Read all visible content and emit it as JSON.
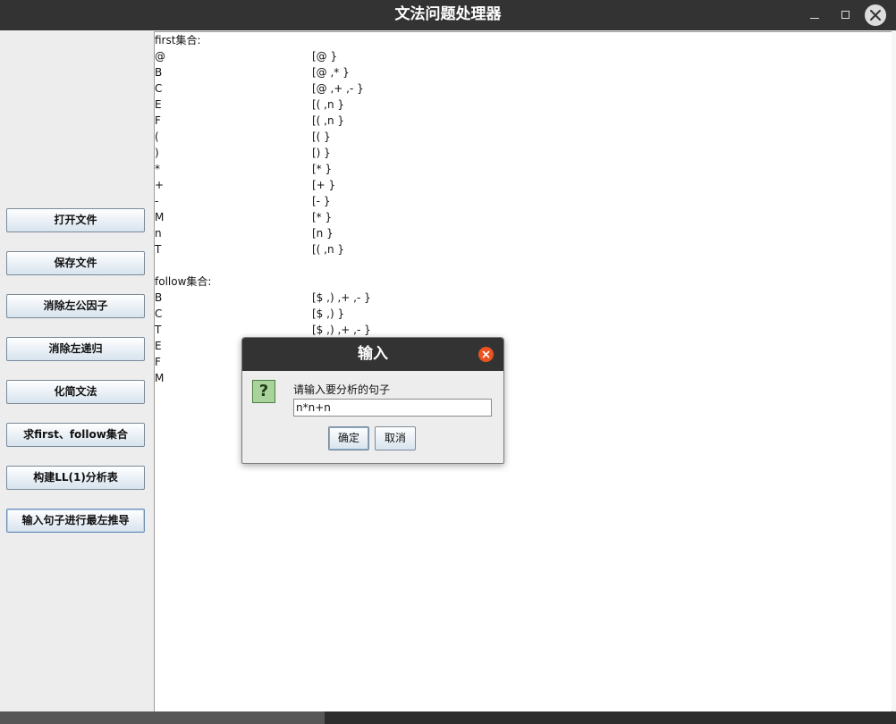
{
  "window": {
    "title": "文法问题处理器"
  },
  "sidebar": {
    "buttons": [
      "打开文件",
      "保存文件",
      "消除左公因子",
      "消除左递归",
      "化简文法",
      "求first、follow集合",
      "构建LL(1)分析表",
      "输入句子进行最左推导"
    ]
  },
  "output": {
    "first_header": "first集合:",
    "first": [
      {
        "sym": "@",
        "set": "[@ }"
      },
      {
        "sym": "B",
        "set": "[@ ,* }"
      },
      {
        "sym": "C",
        "set": "[@ ,+ ,- }"
      },
      {
        "sym": "E",
        "set": "[( ,n }"
      },
      {
        "sym": "F",
        "set": "[( ,n }"
      },
      {
        "sym": "(",
        "set": "[( }"
      },
      {
        "sym": ")",
        "set": "[) }"
      },
      {
        "sym": "*",
        "set": "[* }"
      },
      {
        "sym": "+",
        "set": "[+ }"
      },
      {
        "sym": "-",
        "set": "[- }"
      },
      {
        "sym": "M",
        "set": "[* }"
      },
      {
        "sym": "n",
        "set": "[n }"
      },
      {
        "sym": "T",
        "set": "[( ,n }"
      }
    ],
    "follow_header": "follow集合:",
    "follow": [
      {
        "sym": "B",
        "set": "[$ ,) ,+ ,- }"
      },
      {
        "sym": "C",
        "set": "[$ ,) }"
      },
      {
        "sym": "T",
        "set": "[$ ,) ,+ ,- }"
      },
      {
        "sym": "E",
        "set": ""
      },
      {
        "sym": "F",
        "set": ""
      },
      {
        "sym": "M",
        "set": ""
      }
    ]
  },
  "dialog": {
    "title": "输入",
    "prompt": "请输入要分析的句子",
    "input_value": "n*n+n",
    "ok_label": "确定",
    "cancel_label": "取消",
    "icon_glyph": "?"
  },
  "colors": {
    "titlebar": "#333333",
    "close_accent": "#e95420",
    "question_icon": "#a9d39b"
  }
}
